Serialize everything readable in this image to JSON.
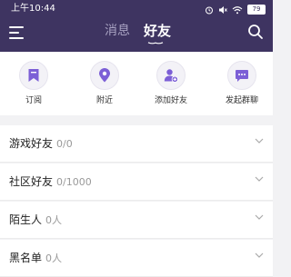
{
  "status": {
    "time": "上午10:44",
    "battery": "79"
  },
  "nav": {
    "tabs": [
      {
        "label": "消息"
      },
      {
        "label": "好友"
      }
    ]
  },
  "actions": [
    {
      "label": "订阅",
      "icon": "bookmark-icon"
    },
    {
      "label": "附近",
      "icon": "location-pin-icon"
    },
    {
      "label": "添加好友",
      "icon": "add-user-icon"
    },
    {
      "label": "发起群聊",
      "icon": "chat-bubble-icon"
    }
  ],
  "groups": [
    {
      "name": "游戏好友",
      "count": "0/0"
    },
    {
      "name": "社区好友",
      "count": "0/1000"
    },
    {
      "name": "陌生人",
      "count": "0人"
    },
    {
      "name": "黑名单",
      "count": "0人"
    }
  ],
  "colors": {
    "header": "#3e3461",
    "accent": "#7c5fd6"
  }
}
